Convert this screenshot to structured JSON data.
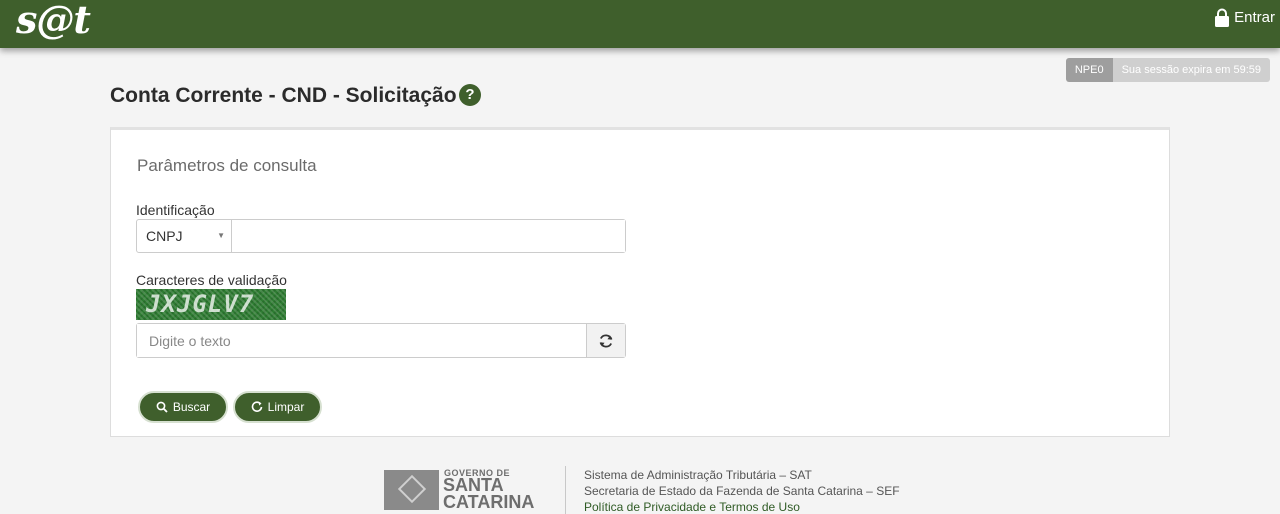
{
  "header": {
    "logo": "s@t",
    "login_label": "Entrar"
  },
  "session": {
    "user": "NPE0",
    "expires": "Sua sessão expira em 59:59"
  },
  "page": {
    "title": "Conta Corrente - CND - Solicitação",
    "help": "?"
  },
  "form": {
    "title": "Parâmetros de consulta",
    "identification_label": "Identificação",
    "identification_type": "CNPJ",
    "identification_value": "",
    "captcha_label": "Caracteres de validação",
    "captcha_text": "JXJGLV7",
    "captcha_placeholder": "Digite o texto",
    "search_label": "Buscar",
    "clear_label": "Limpar"
  },
  "footer": {
    "gov_label": "GOVERNO DE",
    "state_label": "SANTA CATARINA",
    "line1": "Sistema de Administração Tributária – SAT",
    "line2": "Secretaria de Estado da Fazenda de Santa Catarina – SEF",
    "privacy_link": "Política de Privacidade e Termos de Uso"
  },
  "colors": {
    "brand_green": "#3f5f2c",
    "background": "#f4f4f4"
  }
}
